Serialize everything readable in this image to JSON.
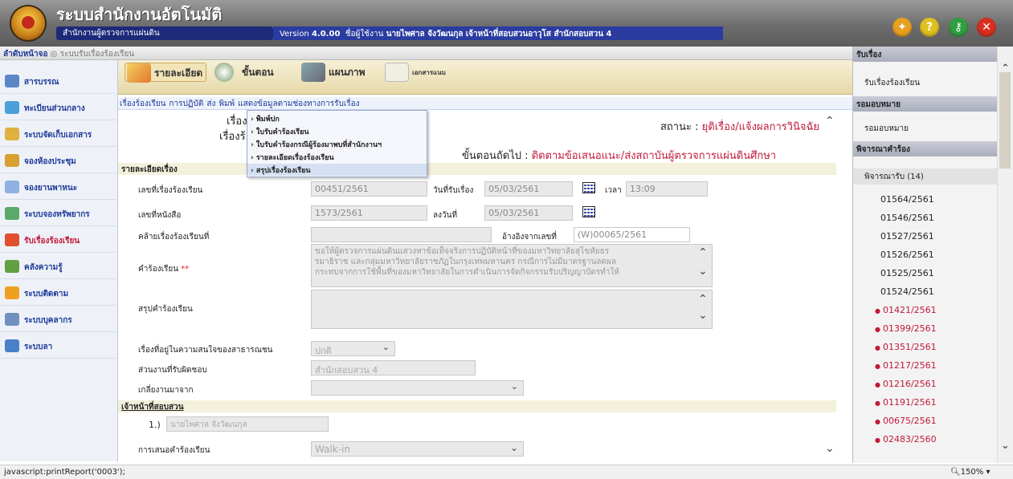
{
  "header": {
    "title": "ระบบสำนักงานอัตโนมัติ",
    "subtitle": "สำนักงานผู้ตรวจการแผ่นดิน",
    "version_prefix": "Version",
    "version": "4.0.00",
    "user_label": "ชื่อผู้ใช้งาน",
    "user_name": "นายไพศาล จังวัฒนกุล",
    "user_role": "เจ้าหน้าที่สอบสวนอาวุโส สำนักสอบสวน 4"
  },
  "breadcrumb": {
    "prefix": "ลำดับหน้าจอ",
    "path": "ระบบรับเรื่องร้องเรียน"
  },
  "sidebar": [
    {
      "label": "สารบรรณ",
      "icon": "mail-icon",
      "color": "#5b86c8"
    },
    {
      "label": "ทะเบียนส่วนกลาง",
      "icon": "register-icon",
      "color": "#4aa0d8"
    },
    {
      "label": "ระบบจัดเก็บเอกสาร",
      "icon": "archive-icon",
      "color": "#e0b040"
    },
    {
      "label": "จองห้องประชุม",
      "icon": "meeting-room-icon",
      "color": "#d8a030"
    },
    {
      "label": "จองยานพาหนะ",
      "icon": "vehicle-icon",
      "color": "#8fb0e0"
    },
    {
      "label": "ระบบจองทรัพยากร",
      "icon": "resource-icon",
      "color": "#5aa86a"
    },
    {
      "label": "รับเรื่องร้องเรียน",
      "icon": "complaint-icon",
      "color": "#e05030"
    },
    {
      "label": "คลังความรู้",
      "icon": "knowledge-icon",
      "color": "#60a040"
    },
    {
      "label": "ระบบติดตาม",
      "icon": "tracking-icon",
      "color": "#f0a020"
    },
    {
      "label": "ระบบบุคลากร",
      "icon": "personnel-icon",
      "color": "#7090c0"
    },
    {
      "label": "ระบบลา",
      "icon": "leave-icon",
      "color": "#4a80c8"
    }
  ],
  "toolbar": {
    "details": "รายละเอียด",
    "steps": "ขั้นตอน",
    "map": "แผนภาพ",
    "attachments": "เอกสารแนบ"
  },
  "menu": [
    "เรื่องร้องเรียน",
    "การปฏิบัติ",
    "ส่ง",
    "พิมพ์",
    "แสดงข้อมูลตามช่องทางการรับเรื่อง"
  ],
  "print_menu": [
    "› พิมพ์ปก",
    "› ใบรับคำร้องเรียน",
    "› ใบรับคำร้องกรณีผู้ร้องมาพบที่สำนักงานฯ",
    "› รายละเอียดเรื่องร้องเรียน",
    "› สรุปเรื่องร้องเรียน"
  ],
  "subject": {
    "line1": "เรื่อง",
    "line2": "เรื่องร้"
  },
  "status": {
    "label": "สถานะ :",
    "value": "ยุติเรื่อง/แจ้งผลการวินิจฉัย"
  },
  "next_step": {
    "label": "ขั้นตอนถัดไป :",
    "value": "ติดตามข้อเสนอแนะ/ส่งสถาบันผู้ตรวจการแผ่นดินศึกษา"
  },
  "section_details": "รายละเอียดเรื่อง",
  "form": {
    "complaint_no_label": "เลขที่เรื่องร้องเรียน",
    "complaint_no": "00451/2561",
    "received_date_label": "วันที่รับเรื่อง",
    "received_date": "05/03/2561",
    "time_label": "เวลา",
    "time": "13:09",
    "letter_no_label": "เลขที่หนังสือ",
    "letter_no": "1573/2561",
    "letter_date_label": "ลงวันที่",
    "letter_date": "05/03/2561",
    "similar_label": "คล้ายเรื่องร้องเรียนที่",
    "similar": "",
    "ref_label": "อ้างอิงจากเลขที่",
    "ref": "(W)00065/2561",
    "request_label": "คำร้องเรียน",
    "required": "**",
    "request_text": [
      "ขอให้ผู้ตรวจการแผ่นดินแสวงหาข้อเท็จจริงการปฏิบัติหน้าที่ของมหาวิทยาลัยสุโขทัยธร",
      "รมาธิราช และกลุ่มมหาวิทยาลัยราชภัฏในกรุงเทพมหานคร กรณีการไม่มีมาตรฐานลดผล",
      "กระทบจากการใช้พื้นที่ของมหาวิทยาลัยในการดำเนินการจัดกิจกรรมรับปริญญาบัตรทำให้"
    ],
    "summary_label": "สรุปคำร้องเรียน",
    "summary": "",
    "public_interest_label": "เรื่องที่อยู่ในความสนใจของสาธารณชน",
    "public_interest": "ปกติ",
    "department_label": "ส่วนงานที่รับผิดชอบ",
    "department": "สำนักสอบสวน 4",
    "mediation_label": "เกลี่ยงานมาจาก",
    "mediation": ""
  },
  "section_officer": "เจ้าหน้าที่สอบสวน",
  "officer": {
    "index": "1.)",
    "name": "นายไพศาล จังวัฒนกุล"
  },
  "channel": {
    "label": "การเสนอคำร้องเรียน",
    "value": "Walk-in"
  },
  "right_panel": {
    "h1": "รับเรื่อง",
    "i1": "รับเรื่องร้องเรียน",
    "h2": "รอมอบหมาย",
    "i2": "รอมอบหมาย",
    "h3": "พิจารณาคำร้อง",
    "i3": "พิจารณารับ (14)",
    "items": [
      {
        "no": "01564/2561",
        "red": false
      },
      {
        "no": "01546/2561",
        "red": false
      },
      {
        "no": "01527/2561",
        "red": false
      },
      {
        "no": "01526/2561",
        "red": false
      },
      {
        "no": "01525/2561",
        "red": false
      },
      {
        "no": "01524/2561",
        "red": false
      },
      {
        "no": "01421/2561",
        "red": true
      },
      {
        "no": "01399/2561",
        "red": true
      },
      {
        "no": "01351/2561",
        "red": true
      },
      {
        "no": "01217/2561",
        "red": true
      },
      {
        "no": "01216/2561",
        "red": true
      },
      {
        "no": "01191/2561",
        "red": true
      },
      {
        "no": "00675/2561",
        "red": true
      },
      {
        "no": "02483/2560",
        "red": true
      }
    ]
  },
  "statusbar": {
    "text": "javascript:printReport('0003');",
    "zoom": "150%"
  }
}
